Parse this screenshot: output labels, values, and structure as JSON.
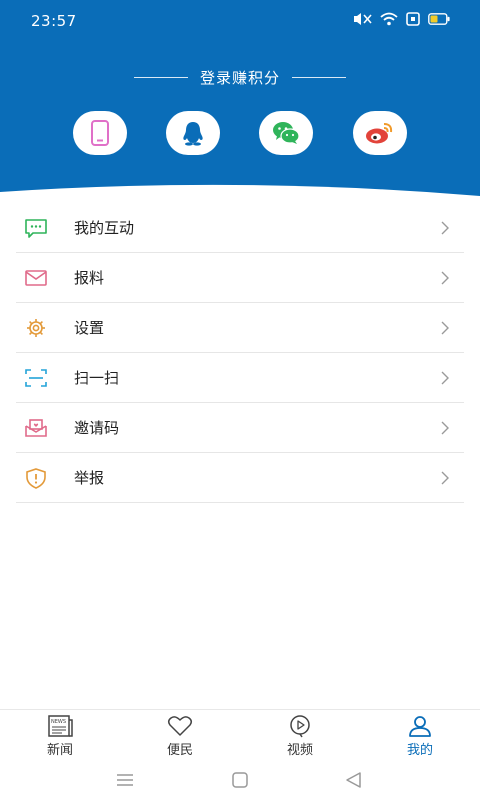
{
  "status": {
    "time": "23:57",
    "icons": [
      "mute-icon",
      "wifi-icon",
      "sim-icon",
      "battery-icon"
    ]
  },
  "login": {
    "title": "登录赚积分",
    "methods": [
      {
        "name": "phone-icon",
        "color": "#e070c8"
      },
      {
        "name": "qq-icon",
        "color": "#0a6db8"
      },
      {
        "name": "wechat-icon",
        "color": "#2fb45a"
      },
      {
        "name": "weibo-icon",
        "color": "#e2433a"
      }
    ]
  },
  "menu": {
    "items": [
      {
        "label": "我的互动",
        "icon": "chat-icon",
        "color": "#2fb45a"
      },
      {
        "label": "报料",
        "icon": "mail-icon",
        "color": "#e06a8a"
      },
      {
        "label": "设置",
        "icon": "gear-icon",
        "color": "#e39a3a"
      },
      {
        "label": "扫一扫",
        "icon": "scan-icon",
        "color": "#23a3d8"
      },
      {
        "label": "邀请码",
        "icon": "invite-icon",
        "color": "#e06a8a"
      },
      {
        "label": "举报",
        "icon": "report-shield-icon",
        "color": "#e39a3a"
      }
    ]
  },
  "tabs": [
    {
      "label": "新闻",
      "icon": "news-icon",
      "active": false
    },
    {
      "label": "便民",
      "icon": "heart-icon",
      "active": false
    },
    {
      "label": "视频",
      "icon": "video-icon",
      "active": false
    },
    {
      "label": "我的",
      "icon": "user-icon",
      "active": true
    }
  ],
  "colors": {
    "brand": "#0a6db8",
    "background": "#ffffff",
    "divider": "#e6e6e6",
    "arrow": "#9a9a9a"
  }
}
